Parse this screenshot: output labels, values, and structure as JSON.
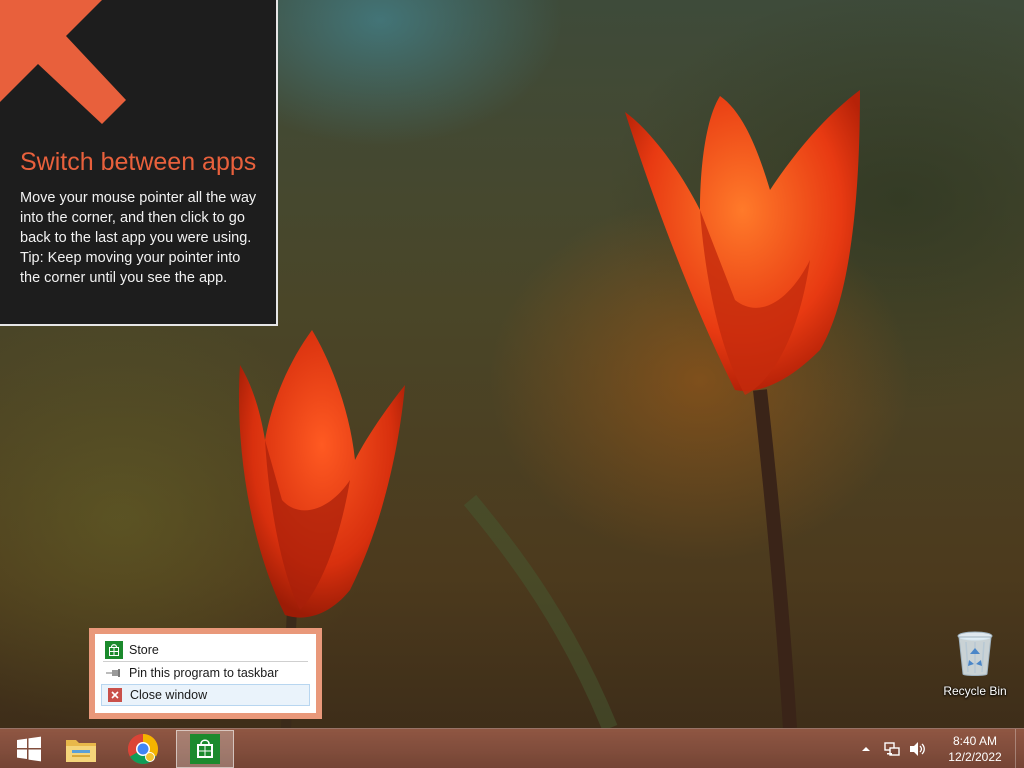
{
  "tip": {
    "title": "Switch between apps",
    "body_line1": "Move your mouse pointer all the way into the corner, and then click to go back to the last app you were using.",
    "body_line2": "Tip: Keep moving your pointer into the corner until you see the app."
  },
  "jump_list": {
    "items": [
      {
        "label": "Store",
        "icon": "store-icon"
      },
      {
        "label": "Pin this program to taskbar",
        "icon": "pin-icon"
      },
      {
        "label": "Close window",
        "icon": "close-icon"
      }
    ]
  },
  "desktop": {
    "recycle_bin_label": "Recycle Bin"
  },
  "taskbar": {
    "apps": [
      {
        "name": "start",
        "icon": "windows-logo-icon"
      },
      {
        "name": "file-explorer",
        "icon": "folder-icon"
      },
      {
        "name": "chrome",
        "icon": "chrome-icon"
      },
      {
        "name": "store",
        "icon": "store-icon",
        "active": true
      }
    ],
    "clock_time": "8:40 AM",
    "clock_date": "12/2/2022"
  },
  "colors": {
    "accent_orange": "#e8603c",
    "taskbar": "#8c5847",
    "jump_list_border": "#e9987a"
  }
}
